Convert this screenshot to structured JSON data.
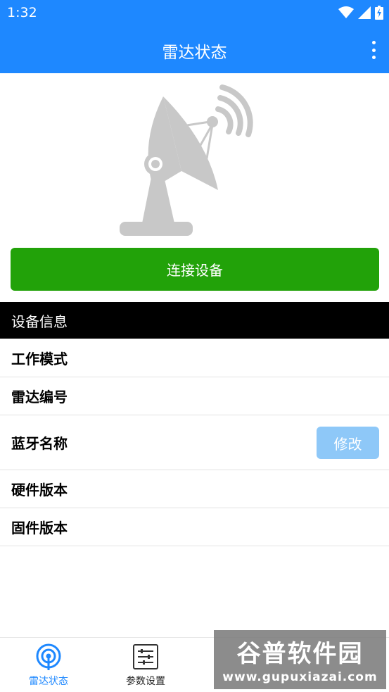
{
  "status_bar": {
    "time": "1:32"
  },
  "app_bar": {
    "title": "雷达状态"
  },
  "connect_button": {
    "label": "连接设备"
  },
  "section": {
    "title": "设备信息"
  },
  "info_rows": [
    {
      "label": "工作模式"
    },
    {
      "label": "雷达编号"
    },
    {
      "label": "蓝牙名称",
      "action_label": "修改"
    },
    {
      "label": "硬件版本"
    },
    {
      "label": "固件版本"
    }
  ],
  "bottom_nav": {
    "items": [
      {
        "label": "雷达状态",
        "icon": "radar-signal-icon",
        "active": true
      },
      {
        "label": "参数设置",
        "icon": "sliders-icon",
        "active": false
      }
    ]
  },
  "watermark": {
    "text": "谷普软件园",
    "url": "www.gupuxiazai.com"
  },
  "colors": {
    "primary": "#1e88ff",
    "connect": "#22a209",
    "edit_button": "#8ec8f8",
    "radar_gray": "#c8c8c8"
  }
}
